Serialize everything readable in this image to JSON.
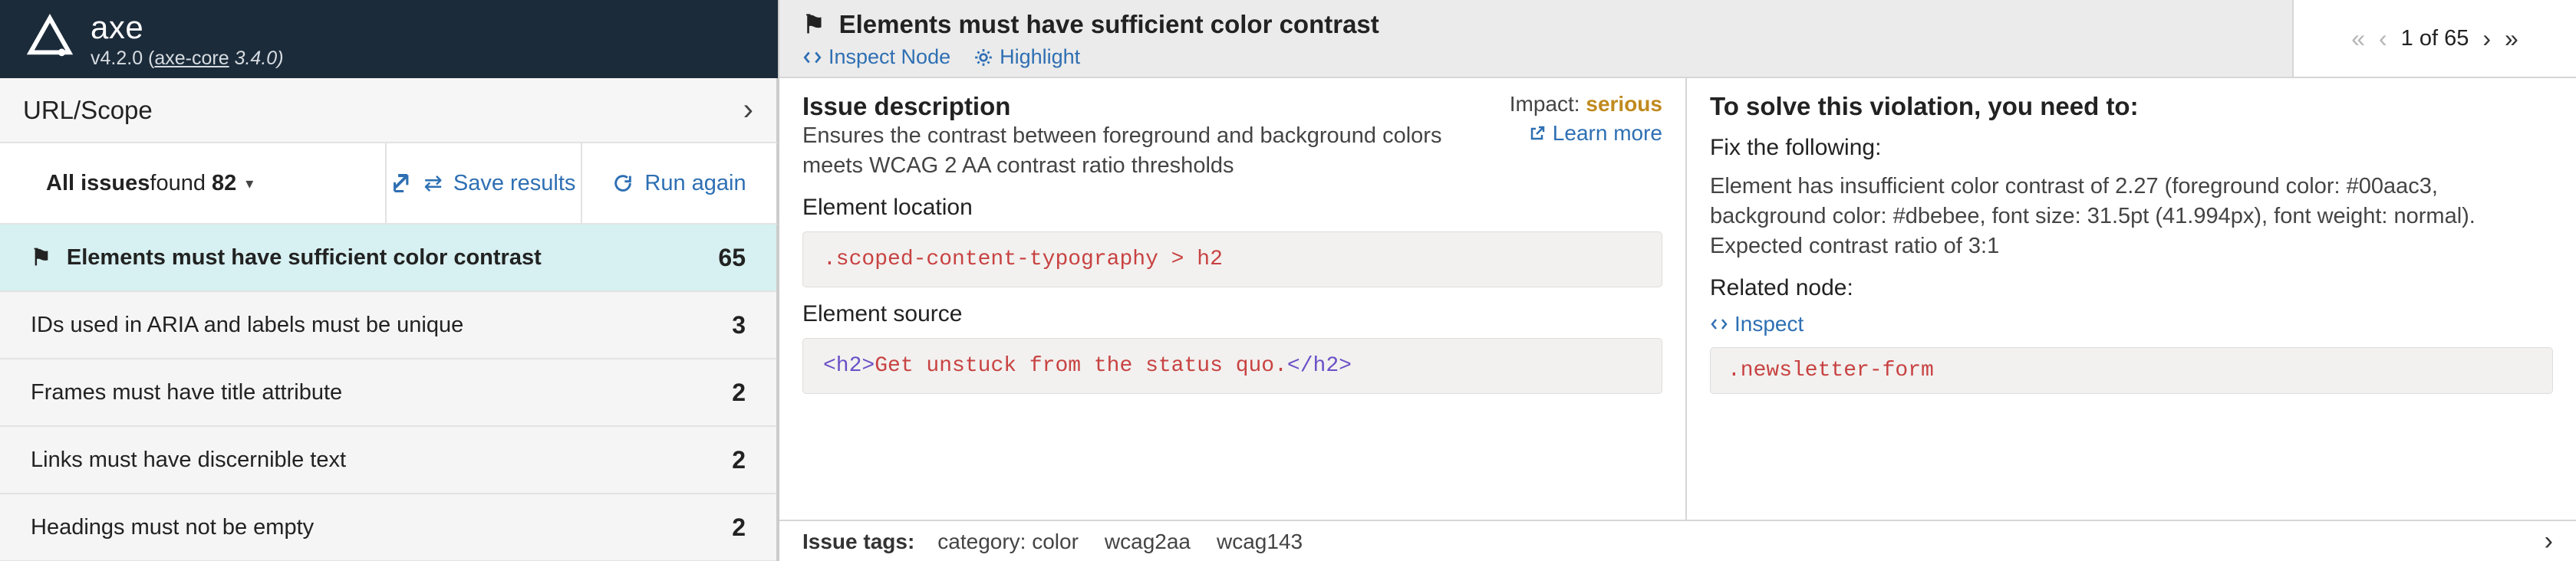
{
  "brand": {
    "name": "axe",
    "version_prefix": "v4.2.0 (",
    "axe_core": "axe-core",
    "axe_core_ver": " 3.4.0)"
  },
  "url_scope": {
    "label": "URL/Scope"
  },
  "issues_bar": {
    "all_issues_label": "All issues",
    "found_label": " found ",
    "count": "82",
    "save_label": "Save results",
    "run_label": "Run again"
  },
  "issues": [
    {
      "title": "Elements must have sufficient color contrast",
      "count": "65",
      "active": true,
      "flag": true
    },
    {
      "title": "IDs used in ARIA and labels must be unique",
      "count": "3"
    },
    {
      "title": "Frames must have title attribute",
      "count": "2"
    },
    {
      "title": "Links must have discernible text",
      "count": "2"
    },
    {
      "title": "Headings must not be empty",
      "count": "2"
    }
  ],
  "detail": {
    "title": "Elements must have sufficient color contrast",
    "inspect_label": "Inspect Node",
    "highlight_label": "Highlight",
    "pagination_text": "1 of 65",
    "issue_desc_h": "Issue description",
    "issue_desc": "Ensures the contrast between foreground and background colors meets WCAG 2 AA contrast ratio thresholds",
    "impact_label": "Impact: ",
    "impact_value": "serious",
    "learn_more": "Learn more",
    "element_location_h": "Element location",
    "element_location_code": ".scoped-content-typography > h2",
    "element_source_h": "Element source",
    "element_source_open": "<h2>",
    "element_source_text": "Get unstuck from the status quo.",
    "element_source_close": "</h2>",
    "solve_h": "To solve this violation, you need to:",
    "fix_label": "Fix the following:",
    "fix_text": "Element has insufficient color contrast of 2.27 (foreground color: #00aac3, background color: #dbebee, font size: 31.5pt (41.994px), font weight: normal). Expected contrast ratio of 3:1",
    "related_label": "Related node:",
    "inspect_link": "Inspect",
    "related_code": ".newsletter-form",
    "tags_label": "Issue tags:",
    "tags": [
      "category: color",
      "wcag2aa",
      "wcag143"
    ]
  }
}
